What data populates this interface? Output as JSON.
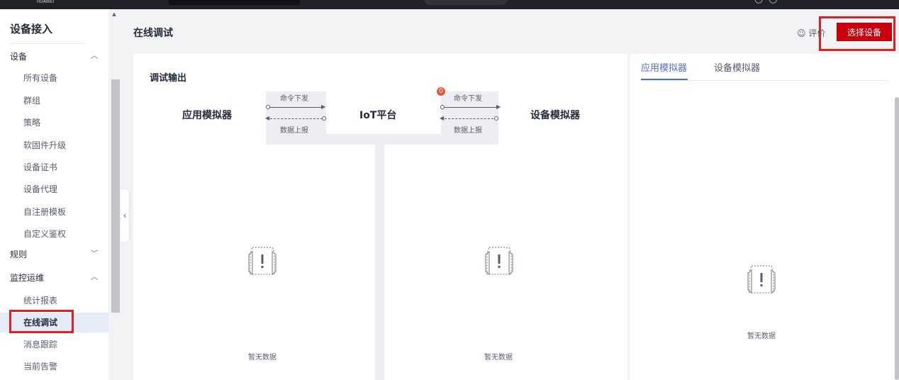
{
  "topbar": {
    "brand": "HUAWEI"
  },
  "sidebar": {
    "title": "设备接入",
    "groups": [
      {
        "label": "设备",
        "chevron": "︿"
      },
      {
        "label": "规则",
        "chevron": "﹀"
      },
      {
        "label": "监控运维",
        "chevron": "︿"
      }
    ],
    "items": [
      {
        "label": "所有设备"
      },
      {
        "label": "群组"
      },
      {
        "label": "策略"
      },
      {
        "label": "软固件升级"
      },
      {
        "label": "设备证书"
      },
      {
        "label": "设备代理"
      },
      {
        "label": "自注册模板"
      },
      {
        "label": "自定义鉴权"
      },
      {
        "label": "统计报表"
      },
      {
        "label": "在线调试"
      },
      {
        "label": "消息跟踪"
      },
      {
        "label": "当前告警"
      }
    ]
  },
  "header": {
    "page_title": "在线调试",
    "rate_icon": "☺",
    "rate_label": "评价",
    "select_device_button": "选择设备"
  },
  "debug_output": {
    "title": "调试输出",
    "app_simulator": "应用模拟器",
    "iot_platform": "IoT平台",
    "device_simulator": "设备模拟器",
    "left_flow": {
      "down": "命令下发",
      "up": "数据上报"
    },
    "right_flow": {
      "down": "命令下发",
      "up": "数据上报",
      "badge": "0"
    },
    "empty_text": "暂无数据"
  },
  "simulator_tabs": {
    "tabs": [
      {
        "label": "应用模拟器"
      },
      {
        "label": "设备模拟器"
      }
    ],
    "empty_text": "暂无数据"
  },
  "colors": {
    "accent": "#526ecc",
    "brand_red": "#c7000b",
    "highlight_red": "#e02020"
  }
}
